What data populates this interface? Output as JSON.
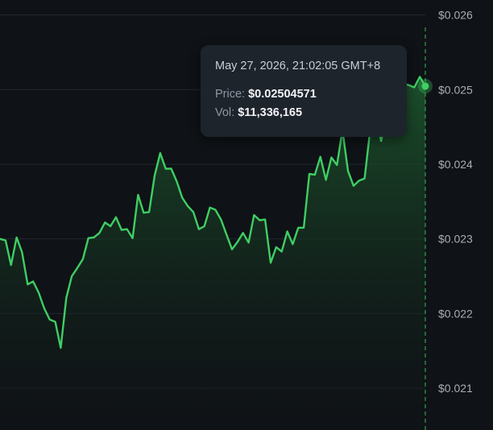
{
  "tooltip": {
    "time": "May 27, 2026, 21:02:05 GMT+8",
    "price_label": "Price:",
    "price_value": "$0.02504571",
    "vol_label": "Vol:",
    "vol_value": "$11,336,165"
  },
  "colors": {
    "background": "#0f1216",
    "line": "#3fce63",
    "fill_top": "#1d5a2e",
    "grid": "#222931",
    "crosshair": "#2fa14c",
    "axis_text": "#a8aeb7"
  },
  "chart_data": {
    "type": "area",
    "y_axis_side": "right",
    "ylim": [
      0.02044,
      0.0262
    ],
    "yticks": [
      "$0.026",
      "$0.025",
      "$0.024",
      "$0.023",
      "$0.022",
      "$0.021"
    ],
    "ytick_values": [
      0.026,
      0.025,
      0.024,
      0.023,
      0.022,
      0.021
    ],
    "grid": true,
    "hover_value": 0.02504571,
    "series": [
      {
        "values": [
          0.023,
          0.02298,
          0.02265,
          0.02302,
          0.02282,
          0.02239,
          0.02243,
          0.02228,
          0.02207,
          0.02192,
          0.02189,
          0.02154,
          0.02221,
          0.0225,
          0.02261,
          0.02273,
          0.02301,
          0.02302,
          0.02308,
          0.02322,
          0.02317,
          0.02329,
          0.02312,
          0.02313,
          0.02301,
          0.02359,
          0.02335,
          0.02336,
          0.02385,
          0.02415,
          0.02394,
          0.02394,
          0.02377,
          0.02355,
          0.02344,
          0.02336,
          0.02313,
          0.02317,
          0.02342,
          0.02339,
          0.02326,
          0.02306,
          0.02286,
          0.02296,
          0.02308,
          0.02295,
          0.02332,
          0.02325,
          0.02326,
          0.02268,
          0.02289,
          0.02283,
          0.0231,
          0.02293,
          0.02315,
          0.02315,
          0.02387,
          0.02386,
          0.0241,
          0.02379,
          0.02409,
          0.02399,
          0.02446,
          0.02391,
          0.02371,
          0.02378,
          0.02381,
          0.02445,
          0.02466,
          0.02431,
          0.02465,
          0.02485,
          0.02496,
          0.02508,
          0.02506,
          0.02503,
          0.02517,
          0.02505
        ]
      }
    ]
  }
}
